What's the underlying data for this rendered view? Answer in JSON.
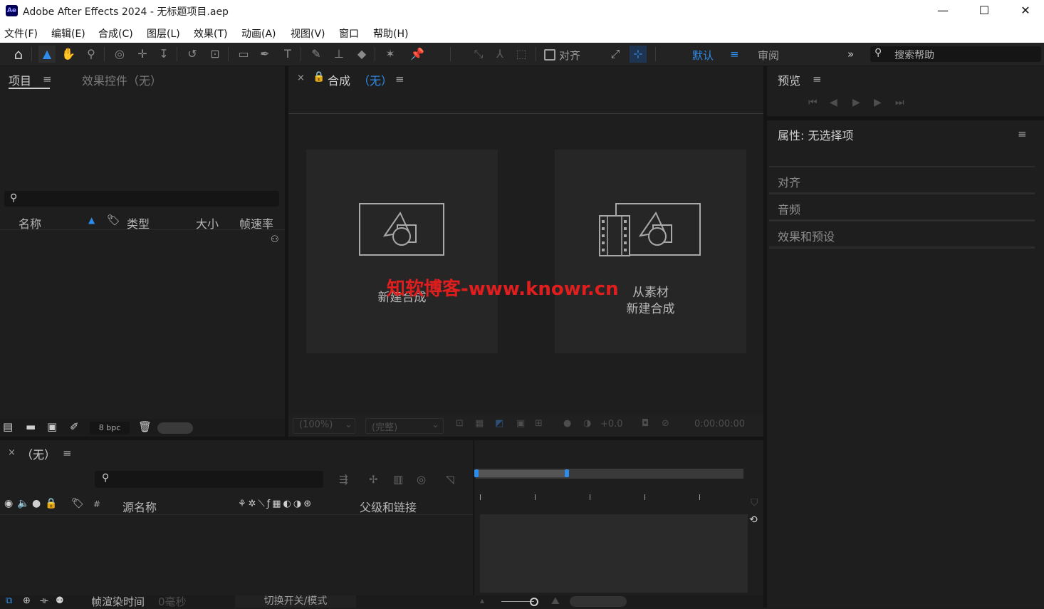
{
  "window": {
    "app_badge": "Ae",
    "title": "Adobe After Effects 2024 - 无标题项目.aep",
    "minimize_icon": "minimize-icon",
    "maximize_icon": "maximize-icon",
    "close_icon": "close-icon"
  },
  "menubar": [
    "文件(F)",
    "编辑(E)",
    "合成(C)",
    "图层(L)",
    "效果(T)",
    "动画(A)",
    "视图(V)",
    "窗口",
    "帮助(H)"
  ],
  "toolbar": {
    "align_label": "对齐",
    "workspace_default": "默认",
    "workspace_review": "审阅",
    "more_icon": "chevron-double-right-icon",
    "search_placeholder": "搜索帮助"
  },
  "project_panel": {
    "tab_project": "项目",
    "tab_effect_controls": "效果控件（无）",
    "columns": [
      "名称",
      "类型",
      "大小",
      "帧速率"
    ],
    "bpc": "8 bpc"
  },
  "comp_panel": {
    "tab_label": "合成",
    "tab_none": "（无）",
    "card1_label": "新建合成",
    "card2_label_line1": "从素材",
    "card2_label_line2": "新建合成",
    "zoom": "(100%)",
    "resolution": "(完整)",
    "exposure": "+0.0",
    "timecode": "0:00:00:00"
  },
  "preview_panel": {
    "title": "预览"
  },
  "properties_panel": {
    "title": "属性: 无选择项",
    "sections": [
      "对齐",
      "音频",
      "效果和预设"
    ]
  },
  "timeline_panel": {
    "tab_label": "（无）",
    "col_source_name": "源名称",
    "col_hash": "#",
    "col_parent": "父级和链接",
    "frame_render_label": "帧渲染时间",
    "frame_render_value": "0毫秒",
    "toggle_modes": "切换开关/模式"
  },
  "watermark": "知软博客-www.knowr.cn",
  "colors": {
    "accent": "#2d8ceb",
    "panel_bg": "#1e1e1e",
    "watermark": "#e01e1e"
  }
}
